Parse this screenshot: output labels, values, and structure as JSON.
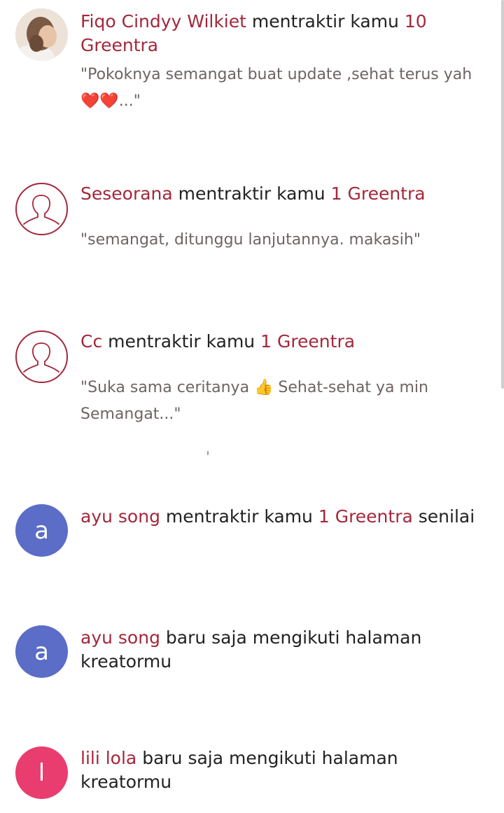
{
  "notifications": [
    {
      "name": "Fiqo Cindyy Wilkiet",
      "action": " mentraktir kamu ",
      "amount": "10 Greentra",
      "suffix": "",
      "message": "\"Pokoknya semangat buat update ,sehat terus yah ❤️❤️...\"",
      "avatar": {
        "type": "photo"
      }
    },
    {
      "name": "Seseorana",
      "action": " mentraktir kamu ",
      "amount": "1 Greentra",
      "suffix": "",
      "message": "\"semangat, ditunggu lanjutannya. makasih\"",
      "avatar": {
        "type": "default-profile-icon"
      }
    },
    {
      "name": "Cc",
      "action": " mentraktir kamu ",
      "amount": "1 Greentra",
      "suffix": "",
      "message": "\"Suka sama ceritanya 👍 Sehat-sehat ya min Semangat...\"",
      "avatar": {
        "type": "default-profile-icon"
      }
    },
    {
      "name": "ayu song",
      "action": " mentraktir kamu ",
      "amount": "1 Greentra",
      "suffix": " senilai",
      "avatar": {
        "type": "letter",
        "letter": "a",
        "color": "#5b6dc6"
      }
    },
    {
      "name": "ayu song",
      "action": " baru saja mengikuti halaman kreatormu",
      "avatar": {
        "type": "letter",
        "letter": "a",
        "color": "#5b6dc6"
      }
    },
    {
      "name": "lili lola",
      "action": " baru saja mengikuti halaman kreatormu",
      "avatar": {
        "type": "letter",
        "letter": "l",
        "color": "#e93d70"
      }
    }
  ],
  "colors": {
    "accent": "#a3283b",
    "message": "#6d6463"
  }
}
